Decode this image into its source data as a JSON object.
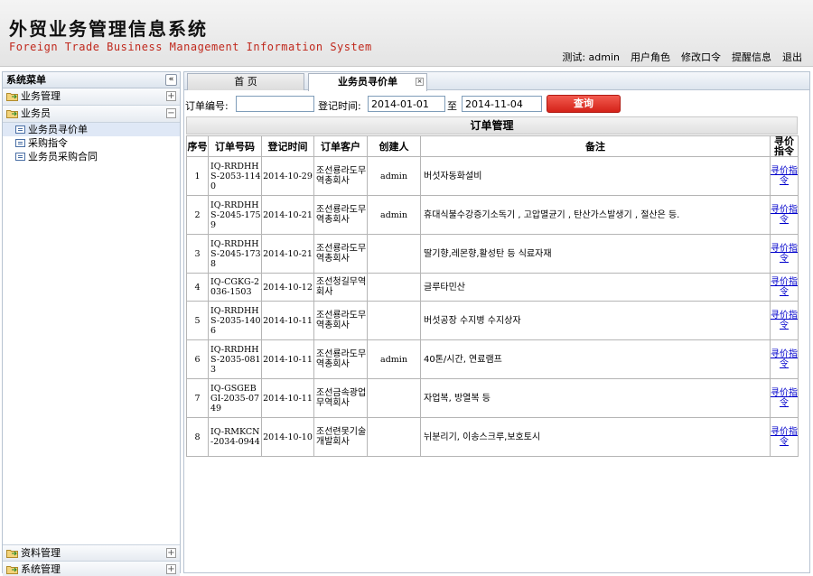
{
  "header": {
    "title": "外贸业务管理信息系统",
    "subtitle": "Foreign Trade Business Management Information System",
    "user_text": "测试: admin",
    "links": [
      "用户角色",
      "修改口令",
      "提醒信息",
      "退出"
    ]
  },
  "sidebar": {
    "title": "系统菜单",
    "collapse_symbol": "«",
    "sections": [
      {
        "label": "业务管理",
        "toggle": "+"
      },
      {
        "label": "业务员",
        "toggle": "−",
        "items": [
          "业务员寻价单",
          "采购指令",
          "业务员采购合同"
        ]
      },
      {
        "label": "资料管理",
        "toggle": "+"
      },
      {
        "label": "系统管理",
        "toggle": "+"
      }
    ]
  },
  "tabs": [
    {
      "label": "首 页"
    },
    {
      "label": "业务员寻价单",
      "close": "×"
    }
  ],
  "search": {
    "order_label": "订单编号:",
    "order_value": "",
    "date_label": "登记时间:",
    "date_from": "2014-01-01",
    "to_label": "至",
    "date_to": "2014-11-04",
    "query_button": "查询"
  },
  "grid": {
    "title": "订单管理",
    "columns": [
      "序号",
      "订单号码",
      "登记时间",
      "订单客户",
      "创建人",
      "备注",
      "寻价指令"
    ],
    "rows": [
      {
        "no": "1",
        "order": "IQ-RRDHHS-2053-1140",
        "date": "2014-10-29",
        "customer": "조선룡라도무역총회사",
        "creator": "admin",
        "note": "버섯자동화설비",
        "action": "寻价指令"
      },
      {
        "no": "2",
        "order": "IQ-RRDHHS-2045-1759",
        "date": "2014-10-21",
        "customer": "조선룡라도무역총회사",
        "creator": "admin",
        "note": "휴대식불수강증기소독기 , 고압멸균기 , 탄산가스발생기 , 절산은 등.",
        "action": "寻价指令"
      },
      {
        "no": "3",
        "order": "IQ-RRDHHS-2045-1738",
        "date": "2014-10-21",
        "customer": "조선룡라도무역총회사",
        "creator": "",
        "note": "딸기향,레몬향,활성탄 등 식료자재",
        "action": "寻价指令"
      },
      {
        "no": "4",
        "order": "IQ-CGKG-2036-1503",
        "date": "2014-10-12",
        "customer": "조선청길무역회사",
        "creator": "",
        "note": "글루타민산",
        "action": "寻价指令"
      },
      {
        "no": "5",
        "order": "IQ-RRDHHS-2035-1406",
        "date": "2014-10-11",
        "customer": "조선룡라도무역총회사",
        "creator": "",
        "note": "버섯공장 수지병 수지상자",
        "action": "寻价指令"
      },
      {
        "no": "6",
        "order": "IQ-RRDHHS-2035-0813",
        "date": "2014-10-11",
        "customer": "조선룡라도무역총회사",
        "creator": "admin",
        "note": "40톤/시간, 연료램프",
        "action": "寻价指令"
      },
      {
        "no": "7",
        "order": "IQ-GSGEBGI-2035-0749",
        "date": "2014-10-11",
        "customer": "조선금속광업무역회사",
        "creator": "",
        "note": "자업복, 방열복 등",
        "action": "寻价指令"
      },
      {
        "no": "8",
        "order": "IQ-RMKCN-2034-0944",
        "date": "2014-10-10",
        "customer": "조선련못기술개발회사",
        "creator": "",
        "note": "뉘분리기, 이송스크루,보호토시",
        "action": "寻价指令"
      }
    ]
  }
}
